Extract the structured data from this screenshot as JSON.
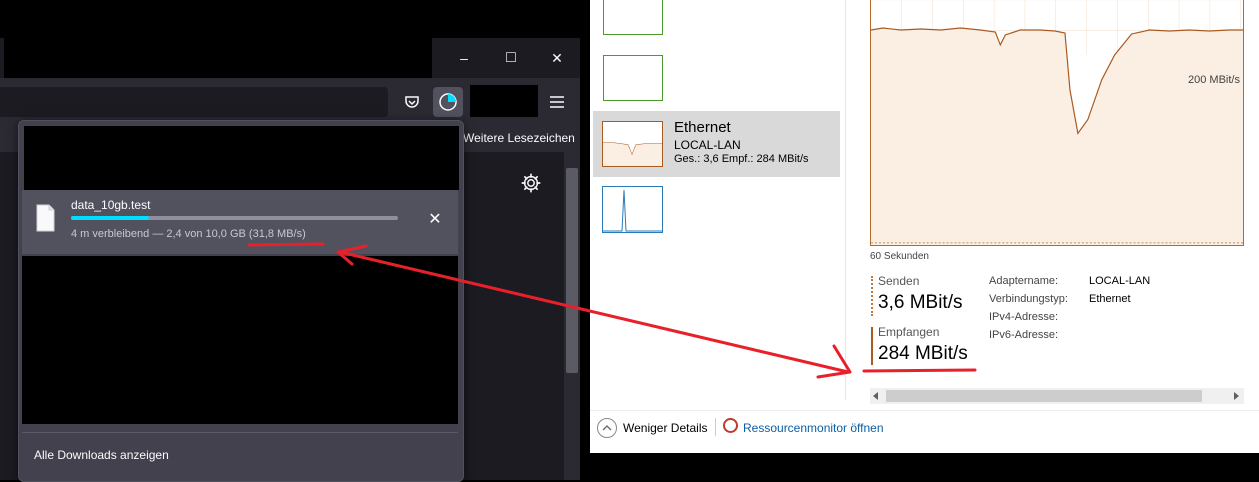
{
  "firefox": {
    "window_controls": {
      "minimize": "–",
      "maximize": "□",
      "close": "✕"
    },
    "bookmarks_label": "Weitere Lesezeichen",
    "download": {
      "filename": "data_10gb.test",
      "progress": 0.24,
      "status_text": "4 m verbleibend — 2,4 von 10,0 GB (31,8 MB/s)",
      "cancel_glyph": "✕"
    },
    "show_all_downloads": "Alle Downloads anzeigen"
  },
  "taskmanager": {
    "ethernet": {
      "title": "Ethernet",
      "adapter": "LOCAL-LAN",
      "summary": "Ges.: 3,6 Empf.: 284 MBit/s"
    },
    "graph_ref_label": "200 MBit/s",
    "time_label": "60 Sekunden",
    "send_label": "Senden",
    "send_value": "3,6 MBit/s",
    "recv_label": "Empfangen",
    "recv_value": "284 MBit/s",
    "details": [
      {
        "key": "Adaptername:",
        "value": "LOCAL-LAN"
      },
      {
        "key": "Verbindungstyp:",
        "value": "Ethernet"
      },
      {
        "key": "IPv4-Adresse:",
        "value": ""
      },
      {
        "key": "IPv6-Adresse:",
        "value": ""
      }
    ],
    "footer": {
      "fewer_details": "Weniger Details",
      "resource_monitor": "Ressourcenmonitor öffnen"
    }
  },
  "colors": {
    "accent_progress": "#00ddff",
    "ethernet_graph": "#a95a1f",
    "annotation": "#e8202a"
  }
}
